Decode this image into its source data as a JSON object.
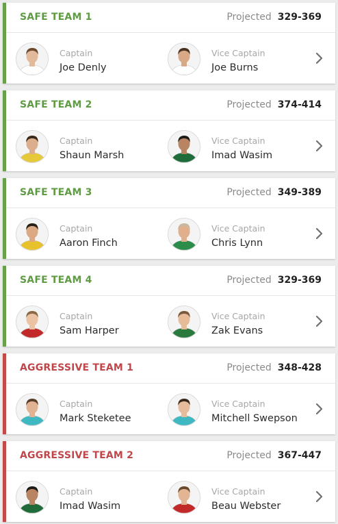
{
  "projected_label": "Projected",
  "teams": [
    {
      "name": "SAFE TEAM 1",
      "kind": "safe",
      "projected": "329-369",
      "captain": {
        "role": "Captain",
        "name": "Joe Denly",
        "kit": "#ffffff",
        "skin": "#e2b99a",
        "hair": "#6b4a2e"
      },
      "vice": {
        "role": "Vice Captain",
        "name": "Joe Burns",
        "kit": "#ffffff",
        "skin": "#d9a887",
        "hair": "#4a3220"
      }
    },
    {
      "name": "SAFE TEAM 2",
      "kind": "safe",
      "projected": "374-414",
      "captain": {
        "role": "Captain",
        "name": "Shaun Marsh",
        "kit": "#e6c93a",
        "skin": "#dcae8d",
        "hair": "#3a2a1c"
      },
      "vice": {
        "role": "Vice Captain",
        "name": "Imad Wasim",
        "kit": "#1f6b3a",
        "skin": "#b88462",
        "hair": "#1e1a16"
      }
    },
    {
      "name": "SAFE TEAM 3",
      "kind": "safe",
      "projected": "349-389",
      "captain": {
        "role": "Captain",
        "name": "Aaron Finch",
        "kit": "#e8c22c",
        "skin": "#dba983",
        "hair": "#2b2016"
      },
      "vice": {
        "role": "Vice Captain",
        "name": "Chris Lynn",
        "kit": "#2c8c4a",
        "skin": "#e0b08c",
        "hair": "#c9b8a0"
      }
    },
    {
      "name": "SAFE TEAM 4",
      "kind": "safe",
      "projected": "329-369",
      "captain": {
        "role": "Captain",
        "name": "Sam Harper",
        "kit": "#c22a2a",
        "skin": "#ebc2a3",
        "hair": "#8a6a46"
      },
      "vice": {
        "role": "Vice Captain",
        "name": "Zak Evans",
        "kit": "#2a7a3e",
        "skin": "#e6bb98",
        "hair": "#7a5a3a"
      }
    },
    {
      "name": "AGGRESSIVE TEAM 1",
      "kind": "aggr",
      "projected": "348-428",
      "captain": {
        "role": "Captain",
        "name": "Mark Steketee",
        "kit": "#3fb8c2",
        "skin": "#e2b393",
        "hair": "#5a4028"
      },
      "vice": {
        "role": "Vice Captain",
        "name": "Mitchell Swepson",
        "kit": "#3fb8c2",
        "skin": "#e6bc9c",
        "hair": "#3a2a1e"
      }
    },
    {
      "name": "AGGRESSIVE TEAM 2",
      "kind": "aggr",
      "projected": "367-447",
      "captain": {
        "role": "Captain",
        "name": "Imad Wasim",
        "kit": "#1f6b3a",
        "skin": "#b88462",
        "hair": "#1e1a16"
      },
      "vice": {
        "role": "Vice Captain",
        "name": "Beau Webster",
        "kit": "#c22a2a",
        "skin": "#e3b595",
        "hair": "#6a4a2c"
      }
    }
  ],
  "colors": {
    "safe_accent": "#67a24a",
    "aggressive_accent": "#c44a4a"
  },
  "icons": {
    "row_action": "chevron-right-icon",
    "player": "player-photo"
  }
}
